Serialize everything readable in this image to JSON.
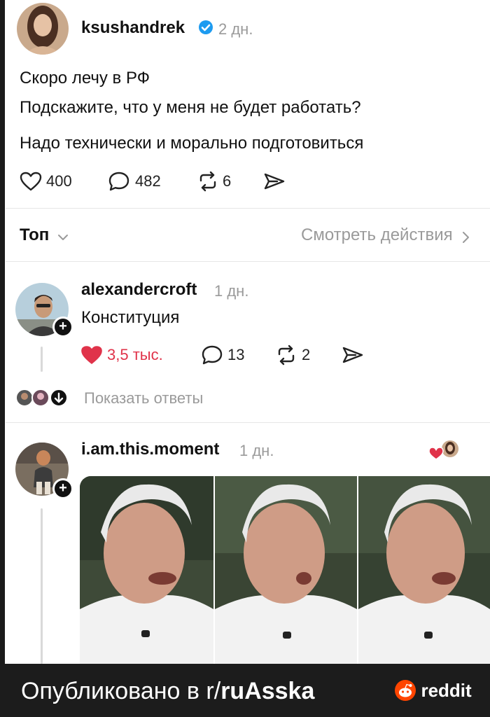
{
  "post": {
    "username": "ksushandrek",
    "time": "2 дн.",
    "lines": [
      "Скоро лечу в РФ",
      "Подскажите, что у меня не будет работать?",
      "Надо технически и морально подготовиться"
    ],
    "likes": "400",
    "comments": "482",
    "reposts": "6"
  },
  "sort": {
    "label": "Топ",
    "view_activity": "Смотреть действия"
  },
  "reply1": {
    "username": "alexandercroft",
    "time": "1 дн.",
    "text": "Конституция",
    "likes": "3,5 тыс.",
    "comments": "13",
    "reposts": "2",
    "show_replies": "Показать ответы"
  },
  "reply2": {
    "username": "i.am.this.moment",
    "time": "1 дн."
  },
  "footer": {
    "published_prefix": "Опубликовано в r/",
    "subreddit": "ruAsska",
    "brand": "reddit"
  },
  "colors": {
    "like_active": "#e0334a",
    "muted": "#9a9a9a",
    "verified": "#1d9bf0",
    "reddit_orange": "#ff4500"
  }
}
